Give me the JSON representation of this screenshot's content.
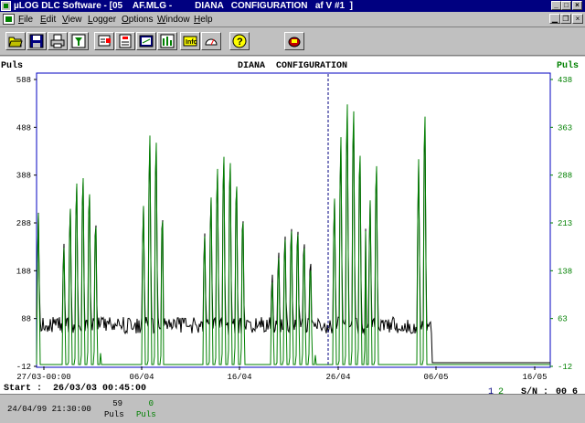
{
  "window": {
    "title": "µLOG DLC Software - [05    AF.MLG -         DIANA   CONFIGURATION   af V #1  ]"
  },
  "menu": {
    "items": [
      {
        "label": "File",
        "ul": "F",
        "rest": "ile"
      },
      {
        "label": "Edit",
        "ul": "E",
        "rest": "dit"
      },
      {
        "label": "View",
        "ul": "V",
        "rest": "iew"
      },
      {
        "label": "Logger",
        "ul": "L",
        "rest": "ogger"
      },
      {
        "label": "Options",
        "ul": "O",
        "rest": "ptions"
      },
      {
        "label": "Window",
        "ul": "W",
        "rest": "indow"
      },
      {
        "label": "Help",
        "ul": "H",
        "rest": "elp"
      }
    ]
  },
  "toolbar": {
    "buttons": [
      {
        "name": "open-folder-icon"
      },
      {
        "name": "save-disk-icon"
      },
      {
        "name": "print-icon"
      },
      {
        "name": "filter-funnel-icon"
      },
      {
        "name": "logger-download-icon"
      },
      {
        "name": "logger-config-icon"
      },
      {
        "name": "logger-display-icon"
      },
      {
        "name": "bar-graph-icon"
      },
      {
        "name": "info-icon"
      },
      {
        "name": "gauge-icon"
      },
      {
        "name": "help-question-icon"
      },
      {
        "name": "logger-device-icon"
      }
    ]
  },
  "colors": {
    "black_series": "#000000",
    "green_series": "#008000",
    "frame": "#0000c0",
    "cursor": "#000080",
    "background": "#ffffff"
  },
  "chart_data": {
    "type": "line",
    "title": "DIANA  CONFIGURATION",
    "left_axis": {
      "label": "Puls",
      "ticks": [
        "588",
        "488",
        "388",
        "288",
        "188",
        "88",
        "-12"
      ],
      "ylim": [
        -12,
        588
      ]
    },
    "right_axis": {
      "label": "Puls",
      "ticks": [
        "438",
        "363",
        "288",
        "213",
        "138",
        "63",
        "-12"
      ],
      "ylim": [
        -12,
        438
      ]
    },
    "x_axis": {
      "ticks": [
        "27/03-00:00",
        "06/04",
        "16/04",
        "26/04",
        "06/05",
        "16/05"
      ]
    },
    "cursor": {
      "time": "24/04/99 21:30:00"
    },
    "series": [
      {
        "color": "black",
        "axis": "left"
      },
      {
        "color": "green",
        "axis": "right"
      }
    ],
    "grid": false
  },
  "footer": {
    "start_label": "Start :",
    "start_value": "26/03/03 00:45:00",
    "legend_1": "1",
    "legend_2": "2",
    "sn_label": "S/N :",
    "sn_value": "00_6"
  },
  "status": {
    "datetime": "24/04/99 21:30:00",
    "ch1_value": "59",
    "ch1_unit": "Puls",
    "ch2_value": "0",
    "ch2_unit": "Puls"
  }
}
